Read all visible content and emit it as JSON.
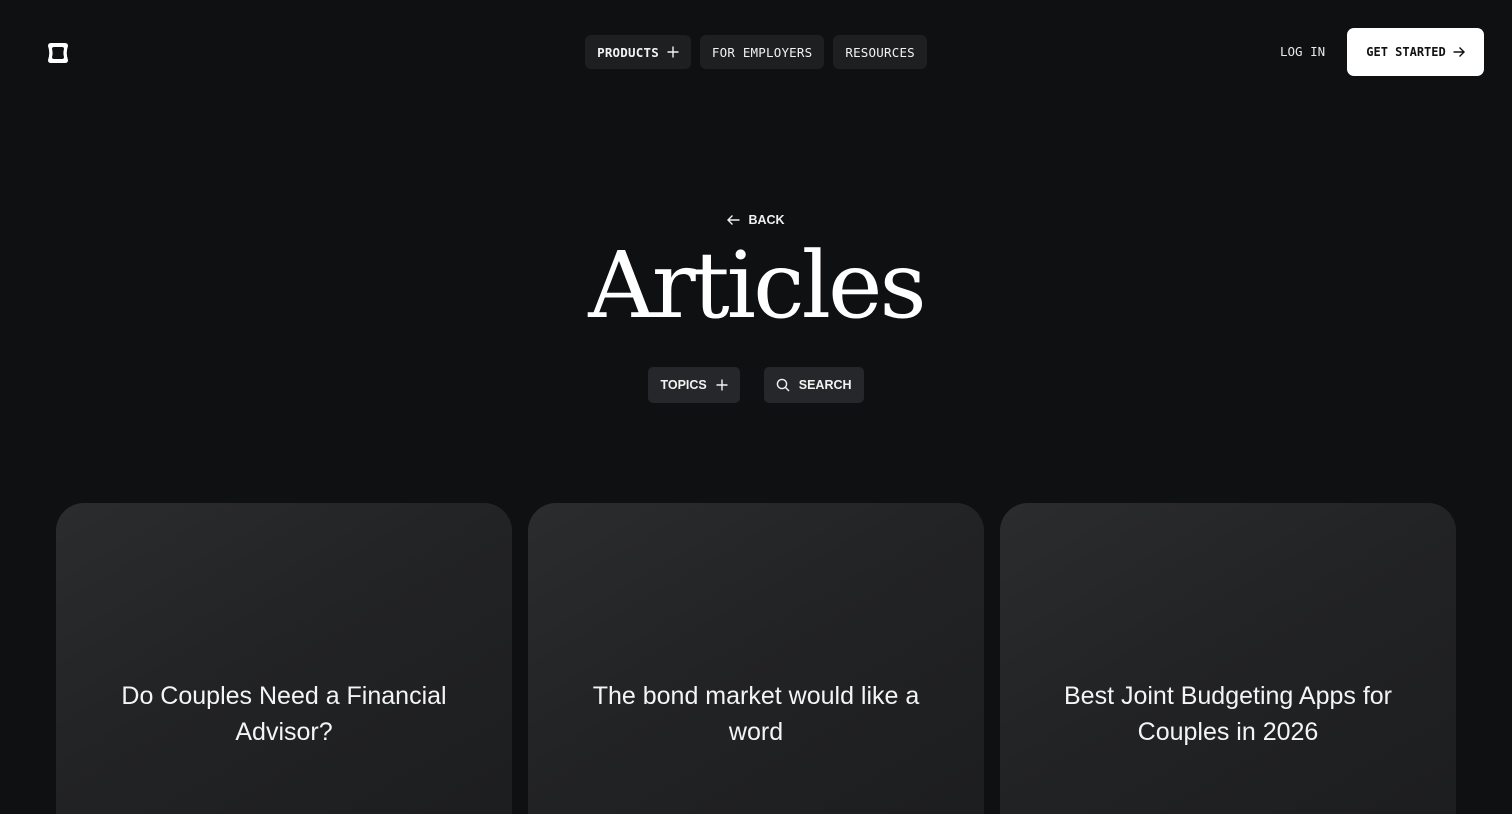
{
  "header": {
    "nav": [
      {
        "label": "PRODUCTS",
        "has_plus": true
      },
      {
        "label": "FOR EMPLOYERS",
        "has_plus": false
      },
      {
        "label": "RESOURCES",
        "has_plus": false
      }
    ],
    "login_label": "LOG IN",
    "cta_label": "GET STARTED"
  },
  "hero": {
    "back_label": "BACK",
    "title": "Articles",
    "topics_label": "TOPICS",
    "search_label": "SEARCH"
  },
  "cards": [
    {
      "title": "Do Couples Need a Financial Advisor?"
    },
    {
      "title": "The bond market would like a word"
    },
    {
      "title": "Best Joint Budgeting Apps for Couples in 2026"
    }
  ],
  "colors": {
    "background": "#0f1012",
    "nav_button": "#1d1f21",
    "cta_background": "#ffffff",
    "card": "#252628"
  }
}
